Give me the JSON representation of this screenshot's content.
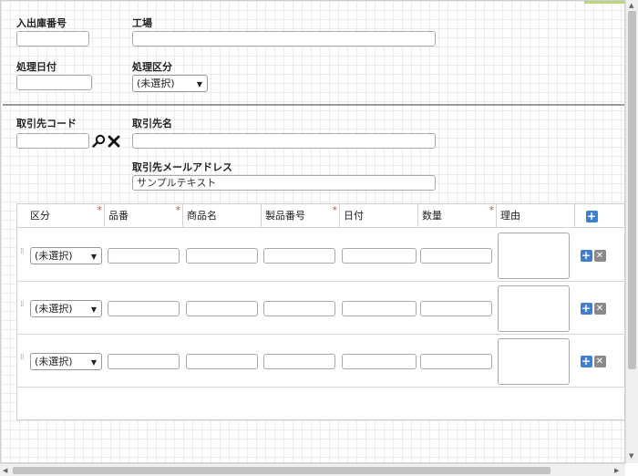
{
  "form": {
    "receipt_number_label": "入出庫番号",
    "receipt_number_value": "",
    "factory_label": "工場",
    "factory_value": "",
    "process_date_label": "処理日付",
    "process_date_value": "",
    "process_type_label": "処理区分",
    "process_type_selected": "(未選択)",
    "customer_code_label": "取引先コード",
    "customer_code_value": "",
    "customer_name_label": "取引先名",
    "customer_name_value": "",
    "customer_email_label": "取引先メールアドレス",
    "customer_email_value": "サンプルテキスト"
  },
  "table": {
    "headers": [
      "区分",
      "品番",
      "商品名",
      "製品番号",
      "日付",
      "数量",
      "理由"
    ],
    "required": [
      true,
      true,
      false,
      true,
      false,
      true,
      false
    ],
    "rows": [
      {
        "category": "(未選択)"
      },
      {
        "category": "(未選択)"
      },
      {
        "category": "(未選択)"
      }
    ]
  },
  "icons": {
    "search": "search-icon",
    "clear": "close-icon",
    "add_row": "plus-icon",
    "delete_row": "delete-icon",
    "drag": "drag-handle-icon"
  },
  "colors": {
    "accent": "#3f7fd0",
    "required_marker": "#e04b1d",
    "divider": "#9a9a9a"
  }
}
